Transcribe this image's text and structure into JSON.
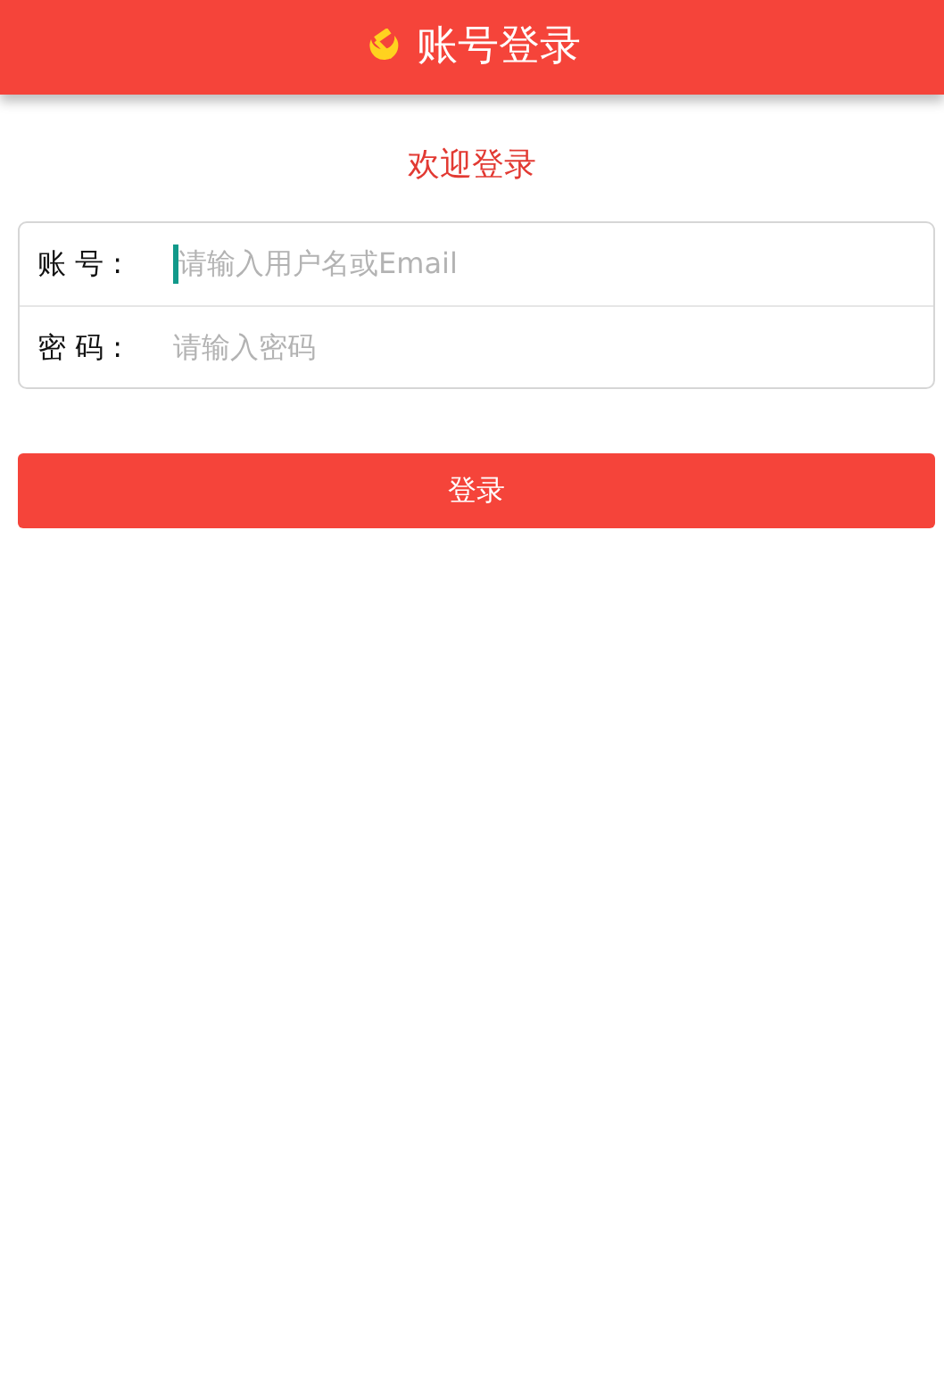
{
  "header": {
    "title": "账号登录"
  },
  "welcome": "欢迎登录",
  "fields": [
    {
      "label": "账 号 :",
      "placeholder": "请输入用户名或Email",
      "focused": true
    },
    {
      "label": "密 码 :",
      "placeholder": "请输入密码",
      "focused": false
    }
  ],
  "button": "登录"
}
